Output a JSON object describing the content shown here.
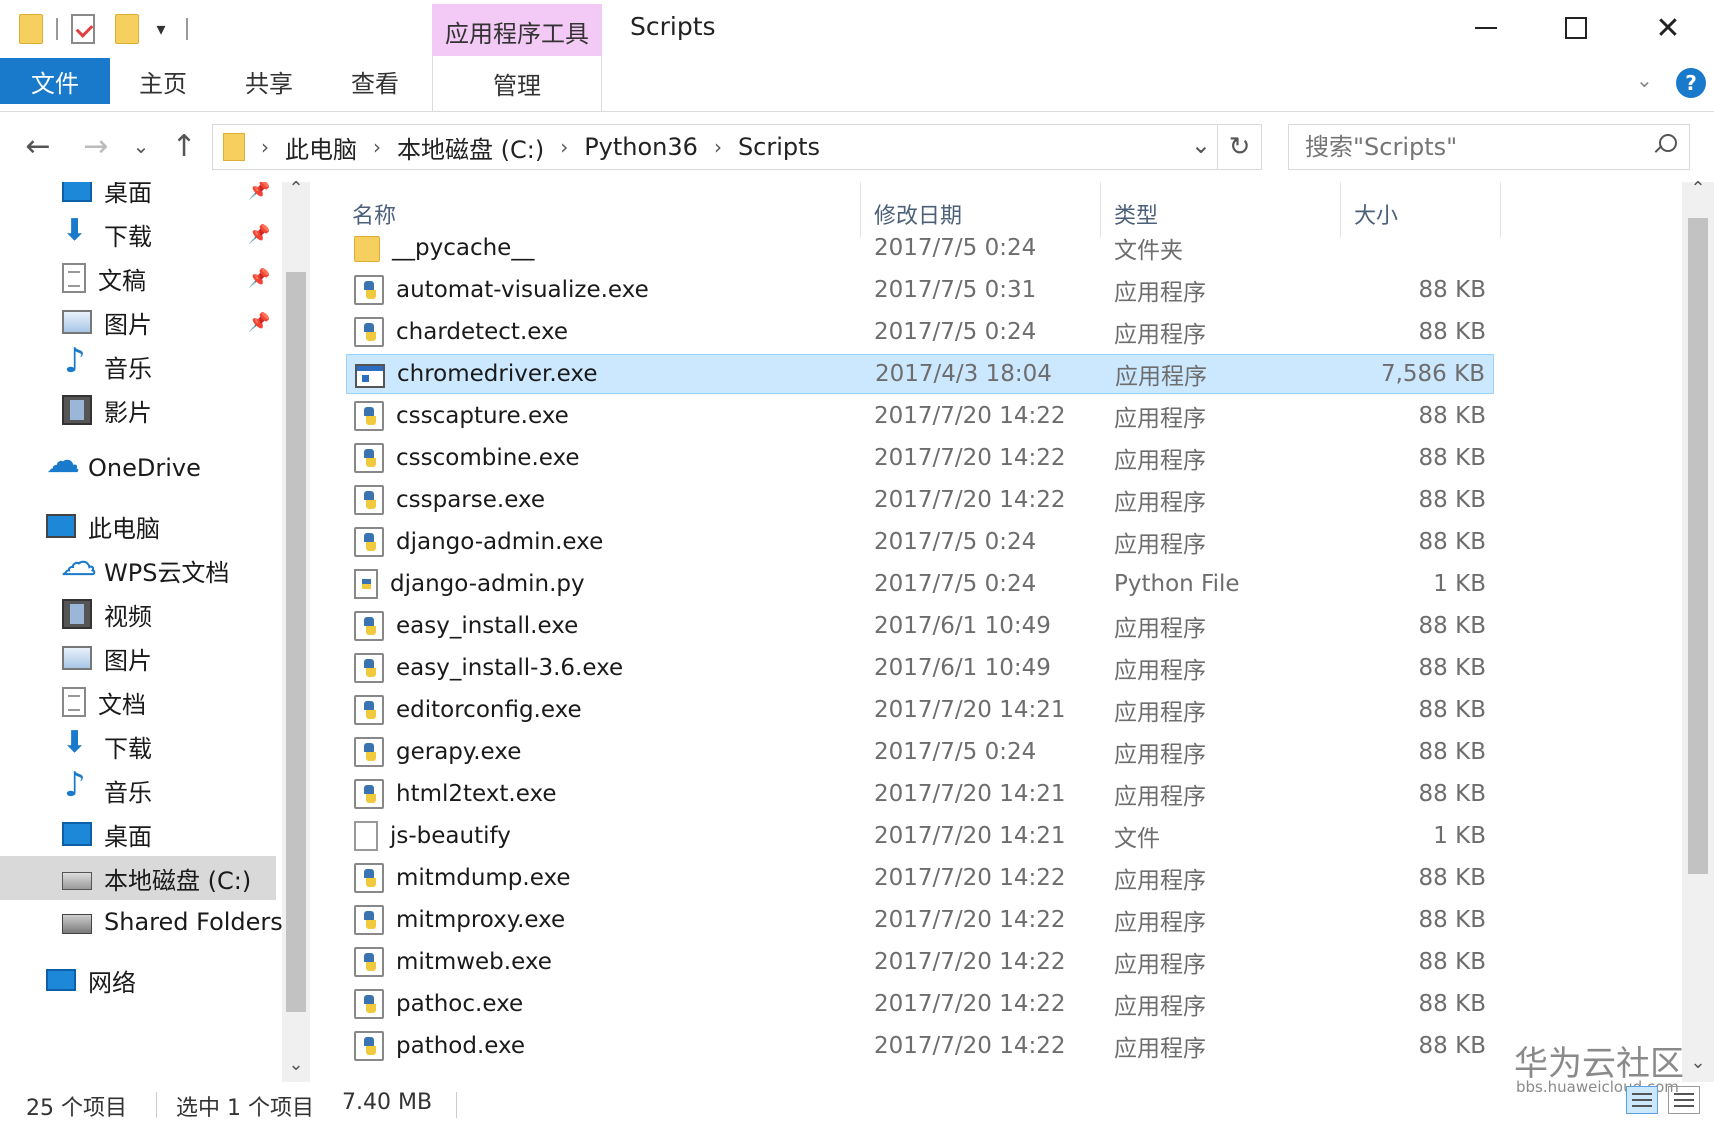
{
  "window": {
    "title": "Scripts",
    "context_tab_group": "应用程序工具",
    "controls": {
      "minimize": "—",
      "maximize": "□",
      "close": "✕"
    }
  },
  "ribbon": {
    "tabs": [
      {
        "label": "文件",
        "active": true
      },
      {
        "label": "主页"
      },
      {
        "label": "共享"
      },
      {
        "label": "查看"
      }
    ],
    "context_tab": "管理",
    "help": "?"
  },
  "address": {
    "crumbs": [
      "此电脑",
      "本地磁盘 (C:)",
      "Python36",
      "Scripts"
    ],
    "separator": "›",
    "dropdown_glyph": "⌄",
    "refresh_glyph": "↻"
  },
  "nav": {
    "back": "←",
    "forward": "→",
    "recent": "⌄",
    "up": "↑"
  },
  "search": {
    "placeholder": "搜索\"Scripts\""
  },
  "navpane": {
    "items": [
      {
        "label": "桌面",
        "icon": "desktop-icon",
        "pinned": true
      },
      {
        "label": "下载",
        "icon": "download-icon",
        "pinned": true
      },
      {
        "label": "文稿",
        "icon": "document-icon",
        "pinned": true
      },
      {
        "label": "图片",
        "icon": "picture-icon",
        "pinned": true
      },
      {
        "label": "音乐",
        "icon": "music-icon"
      },
      {
        "label": "影片",
        "icon": "film-icon"
      },
      {
        "label": "OneDrive",
        "icon": "onedrive-icon"
      },
      {
        "label": "此电脑",
        "icon": "computer-icon"
      },
      {
        "label": "WPS云文档",
        "icon": "wps-cloud-icon"
      },
      {
        "label": "视频",
        "icon": "film-icon"
      },
      {
        "label": "图片",
        "icon": "picture-icon"
      },
      {
        "label": "文档",
        "icon": "document-icon"
      },
      {
        "label": "下载",
        "icon": "download-icon"
      },
      {
        "label": "音乐",
        "icon": "music-icon"
      },
      {
        "label": "桌面",
        "icon": "desktop-icon"
      },
      {
        "label": "本地磁盘 (C:)",
        "icon": "drive-icon",
        "selected": true
      },
      {
        "label": "Shared Folders",
        "icon": "shared-folder-icon"
      },
      {
        "label": "网络",
        "icon": "network-icon"
      }
    ],
    "pin_glyph": "📌"
  },
  "columns": {
    "name": "名称",
    "date": "修改日期",
    "type": "类型",
    "size": "大小"
  },
  "files": [
    {
      "name": "__pycache__",
      "date": "2017/7/5 0:24",
      "type": "文件夹",
      "size": "",
      "icon": "folder-icon"
    },
    {
      "name": "automat-visualize.exe",
      "date": "2017/7/5 0:31",
      "type": "应用程序",
      "size": "88 KB",
      "icon": "python-exe-icon"
    },
    {
      "name": "chardetect.exe",
      "date": "2017/7/5 0:24",
      "type": "应用程序",
      "size": "88 KB",
      "icon": "python-exe-icon"
    },
    {
      "name": "chromedriver.exe",
      "date": "2017/4/3 18:04",
      "type": "应用程序",
      "size": "7,586 KB",
      "icon": "app-window-icon",
      "selected": true
    },
    {
      "name": "csscapture.exe",
      "date": "2017/7/20 14:22",
      "type": "应用程序",
      "size": "88 KB",
      "icon": "python-exe-icon"
    },
    {
      "name": "csscombine.exe",
      "date": "2017/7/20 14:22",
      "type": "应用程序",
      "size": "88 KB",
      "icon": "python-exe-icon"
    },
    {
      "name": "cssparse.exe",
      "date": "2017/7/20 14:22",
      "type": "应用程序",
      "size": "88 KB",
      "icon": "python-exe-icon"
    },
    {
      "name": "django-admin.exe",
      "date": "2017/7/5 0:24",
      "type": "应用程序",
      "size": "88 KB",
      "icon": "python-exe-icon"
    },
    {
      "name": "django-admin.py",
      "date": "2017/7/5 0:24",
      "type": "Python File",
      "size": "1 KB",
      "icon": "python-file-icon"
    },
    {
      "name": "easy_install.exe",
      "date": "2017/6/1 10:49",
      "type": "应用程序",
      "size": "88 KB",
      "icon": "python-exe-icon"
    },
    {
      "name": "easy_install-3.6.exe",
      "date": "2017/6/1 10:49",
      "type": "应用程序",
      "size": "88 KB",
      "icon": "python-exe-icon"
    },
    {
      "name": "editorconfig.exe",
      "date": "2017/7/20 14:21",
      "type": "应用程序",
      "size": "88 KB",
      "icon": "python-exe-icon"
    },
    {
      "name": "gerapy.exe",
      "date": "2017/7/5 0:24",
      "type": "应用程序",
      "size": "88 KB",
      "icon": "python-exe-icon"
    },
    {
      "name": "html2text.exe",
      "date": "2017/7/20 14:21",
      "type": "应用程序",
      "size": "88 KB",
      "icon": "python-exe-icon"
    },
    {
      "name": "js-beautify",
      "date": "2017/7/20 14:21",
      "type": "文件",
      "size": "1 KB",
      "icon": "blank-file-icon"
    },
    {
      "name": "mitmdump.exe",
      "date": "2017/7/20 14:22",
      "type": "应用程序",
      "size": "88 KB",
      "icon": "python-exe-icon"
    },
    {
      "name": "mitmproxy.exe",
      "date": "2017/7/20 14:22",
      "type": "应用程序",
      "size": "88 KB",
      "icon": "python-exe-icon"
    },
    {
      "name": "mitmweb.exe",
      "date": "2017/7/20 14:22",
      "type": "应用程序",
      "size": "88 KB",
      "icon": "python-exe-icon"
    },
    {
      "name": "pathoc.exe",
      "date": "2017/7/20 14:22",
      "type": "应用程序",
      "size": "88 KB",
      "icon": "python-exe-icon"
    },
    {
      "name": "pathod.exe",
      "date": "2017/7/20 14:22",
      "type": "应用程序",
      "size": "88 KB",
      "icon": "python-exe-icon"
    }
  ],
  "status": {
    "count": "25 个项目",
    "selection": "选中 1 个项目",
    "selection_size": "7.40 MB"
  },
  "watermark": {
    "text": "华为云社区",
    "url": "bbs.huaweicloud.com"
  },
  "colors": {
    "accent": "#1979ca",
    "selection_bg": "#cce8ff",
    "context_tab": "#f3c9f5"
  }
}
